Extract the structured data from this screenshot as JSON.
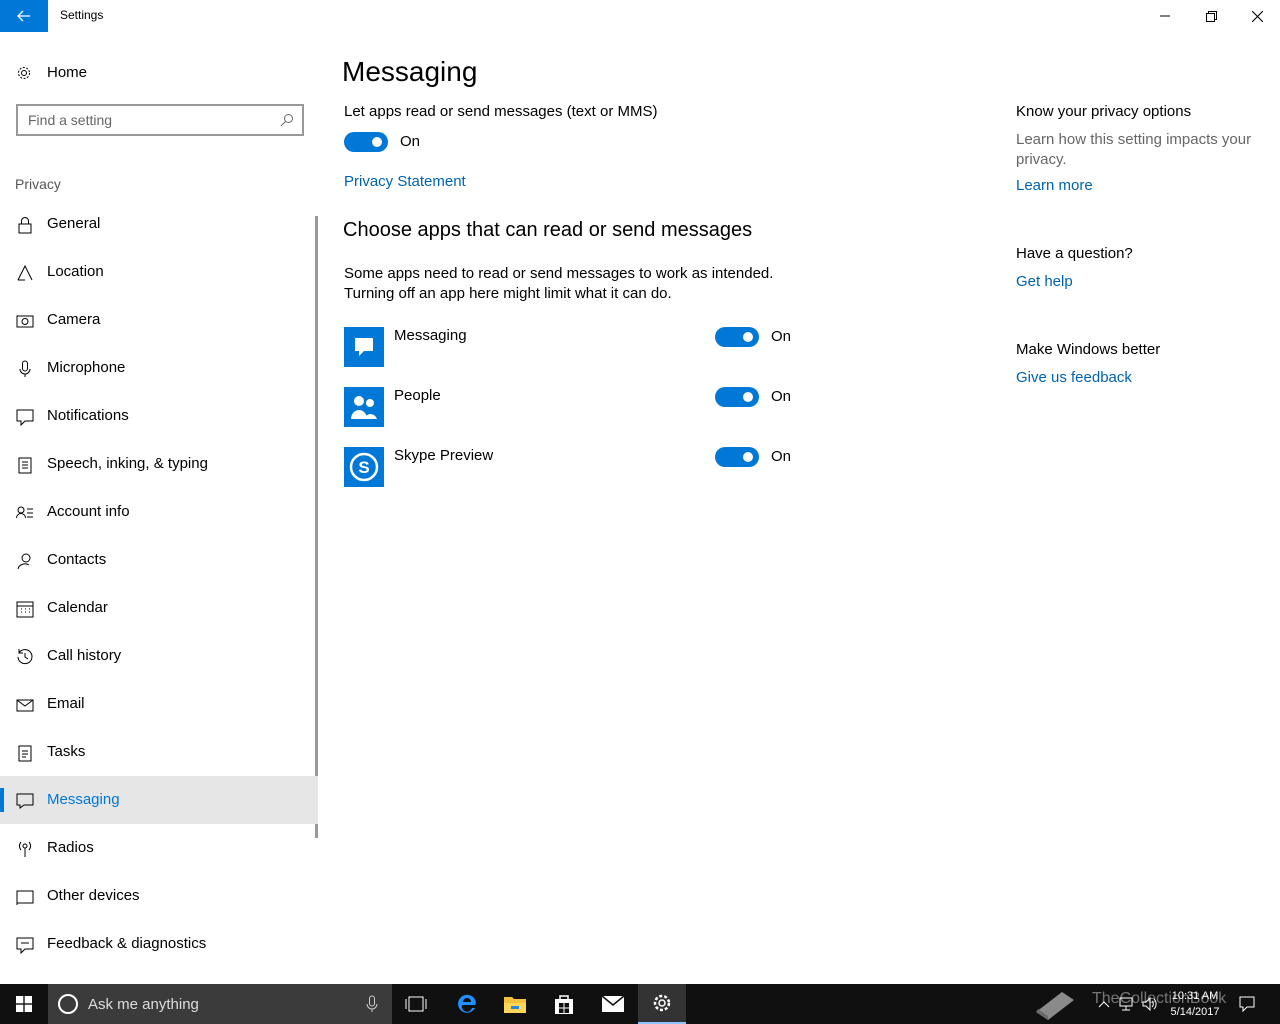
{
  "window": {
    "title": "Settings"
  },
  "sidebar": {
    "home_label": "Home",
    "search_placeholder": "Find a setting",
    "section": "Privacy",
    "items": [
      {
        "label": "General",
        "icon": "lock-icon"
      },
      {
        "label": "Location",
        "icon": "location-icon"
      },
      {
        "label": "Camera",
        "icon": "camera-icon"
      },
      {
        "label": "Microphone",
        "icon": "microphone-icon"
      },
      {
        "label": "Notifications",
        "icon": "notifications-icon"
      },
      {
        "label": "Speech, inking, & typing",
        "icon": "speech-icon"
      },
      {
        "label": "Account info",
        "icon": "account-info-icon"
      },
      {
        "label": "Contacts",
        "icon": "contacts-icon"
      },
      {
        "label": "Calendar",
        "icon": "calendar-icon"
      },
      {
        "label": "Call history",
        "icon": "history-icon"
      },
      {
        "label": "Email",
        "icon": "email-icon"
      },
      {
        "label": "Tasks",
        "icon": "tasks-icon"
      },
      {
        "label": "Messaging",
        "icon": "messaging-icon",
        "selected": true
      },
      {
        "label": "Radios",
        "icon": "radios-icon"
      },
      {
        "label": "Other devices",
        "icon": "other-devices-icon"
      },
      {
        "label": "Feedback & diagnostics",
        "icon": "feedback-icon"
      }
    ]
  },
  "main": {
    "title": "Messaging",
    "setting_label": "Let apps read or send messages (text or MMS)",
    "main_toggle_state": "On",
    "privacy_link": "Privacy Statement",
    "choose_header": "Choose apps that can read or send messages",
    "description_line1": "Some apps need to read or send messages to work as intended.",
    "description_line2": "Turning off an app here might limit what it can do.",
    "apps": [
      {
        "name": "Messaging",
        "state": "On",
        "icon": "messaging-app-icon"
      },
      {
        "name": "People",
        "state": "On",
        "icon": "people-app-icon"
      },
      {
        "name": "Skype Preview",
        "state": "On",
        "icon": "skype-app-icon"
      }
    ]
  },
  "right_pane": {
    "privacy_header": "Know your privacy options",
    "privacy_text": "Learn how this setting impacts your privacy.",
    "learn_more": "Learn more",
    "question_header": "Have a question?",
    "get_help": "Get help",
    "better_header": "Make Windows better",
    "feedback_link": "Give us feedback"
  },
  "taskbar": {
    "search_placeholder": "Ask me anything",
    "time": "10:31 AM",
    "date": "5/14/2017",
    "watermark": "TheCollectionBook"
  },
  "colors": {
    "accent": "#0078d7",
    "link": "#0063b1",
    "taskbar": "#101010"
  }
}
